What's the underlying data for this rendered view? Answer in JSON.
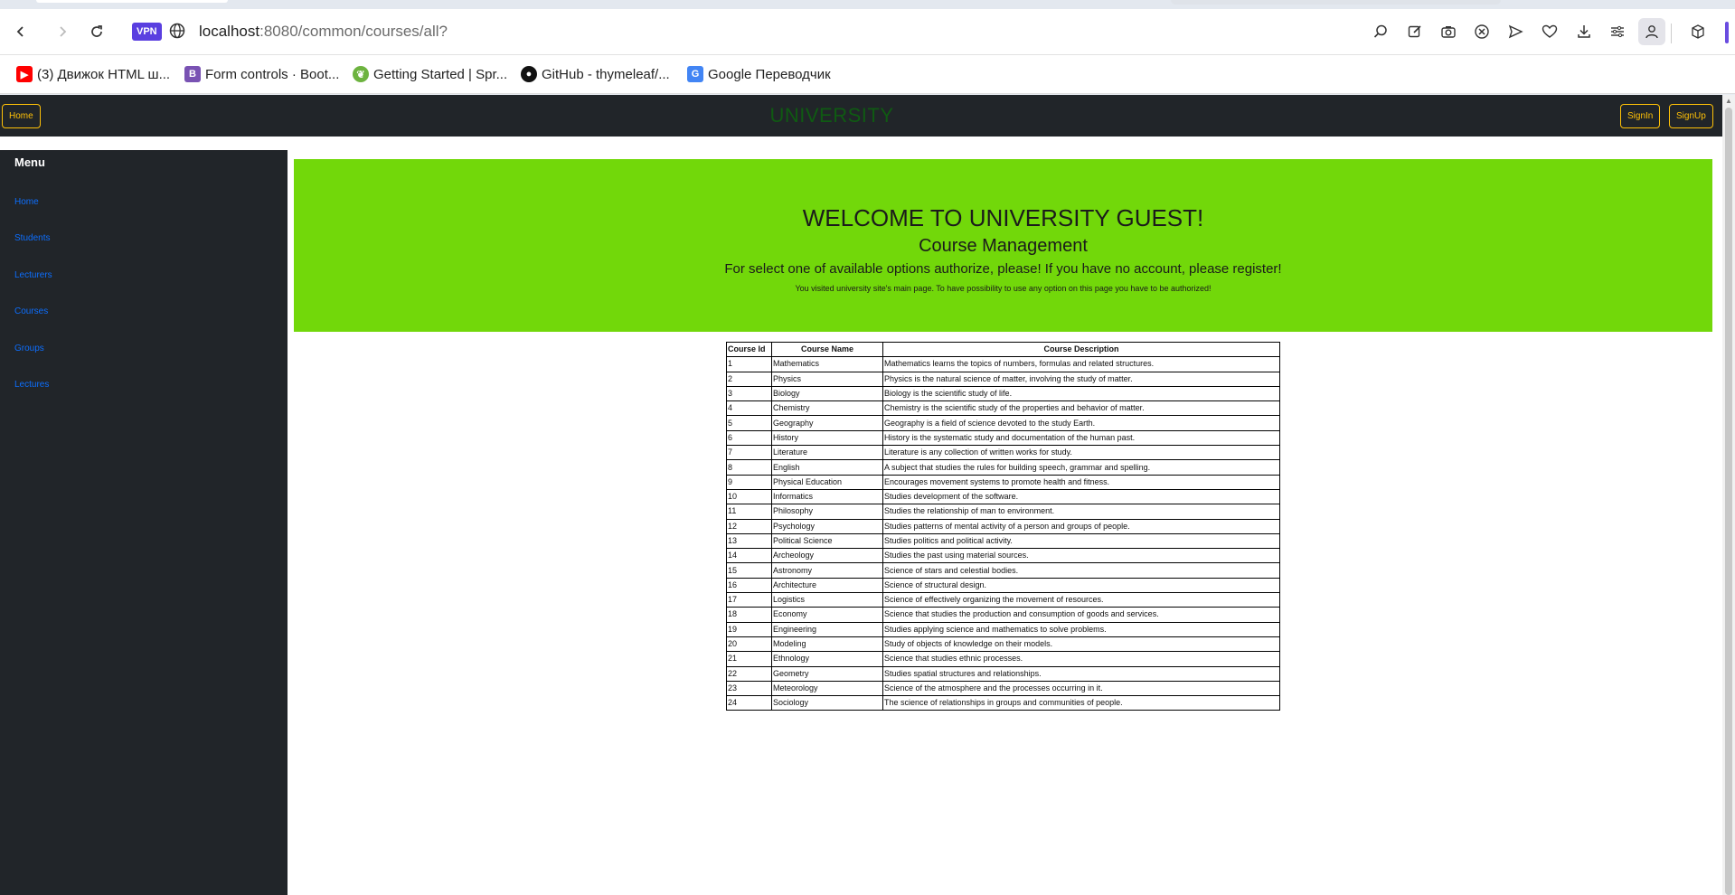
{
  "browser": {
    "vpn_label": "VPN",
    "url_host": "localhost",
    "url_path": ":8080/common/courses/all?",
    "bookmarks": [
      {
        "label": "(3) Движок HTML ш...",
        "icon": "youtube-icon",
        "color": "#ff0000"
      },
      {
        "label": "Form controls · Boot...",
        "icon": "bootstrap-icon",
        "color": "#7952b3"
      },
      {
        "label": "Getting Started | Spr...",
        "icon": "spring-icon",
        "color": "#6db33f"
      },
      {
        "label": "GitHub - thymeleaf/...",
        "icon": "github-icon",
        "color": "#111111"
      },
      {
        "label": "Google Переводчик",
        "icon": "google-translate-icon",
        "color": "#4285f4"
      }
    ]
  },
  "header": {
    "home_label": "Home",
    "brand": "UNIVERSITY",
    "signin_label": "SignIn",
    "signup_label": "SignUp"
  },
  "sidebar": {
    "title": "Menu",
    "items": [
      {
        "label": "Home"
      },
      {
        "label": "Students"
      },
      {
        "label": "Lecturers"
      },
      {
        "label": "Courses"
      },
      {
        "label": "Groups"
      },
      {
        "label": "Lectures"
      }
    ]
  },
  "banner": {
    "welcome": "WELCOME TO UNIVERSITY GUEST!",
    "subtitle": "Course Management",
    "prompt": "For select one of available options authorize, please! If you have no account, please register!",
    "note": "You visited university site's main page. To have possibility to use any option on this page you have to be authorized!"
  },
  "table": {
    "headers": [
      "Course Id",
      "Course Name",
      "Course Description"
    ],
    "rows": [
      [
        "1",
        "Mathematics",
        "Mathematics learns the topics of numbers, formulas and related structures."
      ],
      [
        "2",
        "Physics",
        "Physics is the natural science of matter, involving the study of matter."
      ],
      [
        "3",
        "Biology",
        "Biology is the scientific study of life."
      ],
      [
        "4",
        "Chemistry",
        "Chemistry is the scientific study of the properties and behavior of matter."
      ],
      [
        "5",
        "Geography",
        "Geography is a field of science devoted to the study Earth."
      ],
      [
        "6",
        "History",
        "History is the systematic study and documentation of the human past."
      ],
      [
        "7",
        "Literature",
        "Literature is any collection of written works for study."
      ],
      [
        "8",
        "English",
        "A subject that studies the rules for building speech, grammar and spelling."
      ],
      [
        "9",
        "Physical Education",
        "Encourages movement systems to promote health and fitness."
      ],
      [
        "10",
        "Informatics",
        "Studies development of the software."
      ],
      [
        "11",
        "Philosophy",
        "Studies the relationship of man to environment."
      ],
      [
        "12",
        "Psychology",
        "Studies patterns of mental activity of a person and groups of people."
      ],
      [
        "13",
        "Political Science",
        "Studies politics and political activity."
      ],
      [
        "14",
        "Archeology",
        "Studies the past using material sources."
      ],
      [
        "15",
        "Astronomy",
        "Science of stars and celestial bodies."
      ],
      [
        "16",
        "Architecture",
        "Science of structural design."
      ],
      [
        "17",
        "Logistics",
        "Science of effectively organizing the movement of resources."
      ],
      [
        "18",
        "Economy",
        "Science that studies the production and consumption of goods and services."
      ],
      [
        "19",
        "Engineering",
        "Studies applying science and mathematics to solve problems."
      ],
      [
        "20",
        "Modeling",
        "Study of objects of knowledge on their models."
      ],
      [
        "21",
        "Ethnology",
        "Science that studies ethnic processes."
      ],
      [
        "22",
        "Geometry",
        "Studies spatial structures and relationships."
      ],
      [
        "23",
        "Meteorology",
        "Science of the atmosphere and the processes occurring in it."
      ],
      [
        "24",
        "Sociology",
        "The science of relationships in groups and communities of people."
      ]
    ]
  },
  "colors": {
    "navbar": "#212529",
    "accent_outline": "#ffc107",
    "brand_text": "#0f5a12",
    "banner": "#72d80a",
    "link": "#0d6efd"
  }
}
